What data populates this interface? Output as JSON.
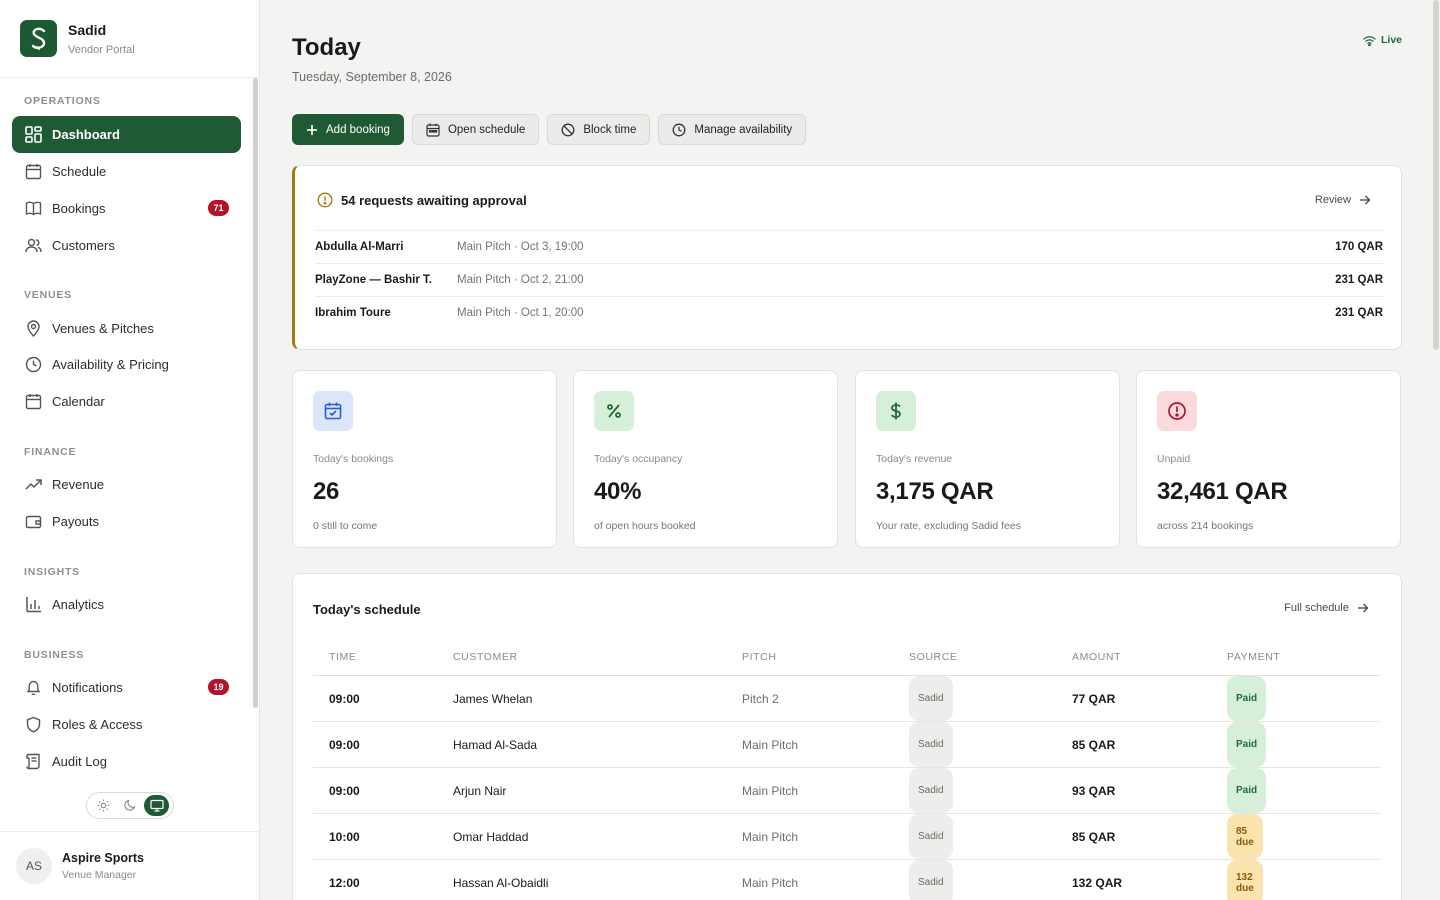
{
  "brand": {
    "name": "Sadid",
    "subtitle": "Vendor Portal"
  },
  "sidebar": {
    "sections": {
      "operations": "OPERATIONS",
      "venues": "VENUES",
      "finance": "FINANCE",
      "insights": "INSIGHTS",
      "business": "BUSINESS"
    },
    "items": [
      {
        "label": "Dashboard",
        "icon": "grid-icon",
        "active": true
      },
      {
        "label": "Schedule",
        "icon": "calendar-icon"
      },
      {
        "label": "Bookings",
        "icon": "book-icon",
        "badge": "71"
      },
      {
        "label": "Customers",
        "icon": "users-icon"
      },
      {
        "label": "Venues & Pitches",
        "icon": "map-pin-icon"
      },
      {
        "label": "Availability & Pricing",
        "icon": "clock-icon"
      },
      {
        "label": "Calendar",
        "icon": "calendar-icon"
      },
      {
        "label": "Revenue",
        "icon": "trending-up-icon"
      },
      {
        "label": "Payouts",
        "icon": "wallet-icon"
      },
      {
        "label": "Analytics",
        "icon": "bar-chart-icon"
      },
      {
        "label": "Notifications",
        "icon": "bell-icon",
        "badge": "19"
      },
      {
        "label": "Roles & Access",
        "icon": "shield-icon"
      },
      {
        "label": "Audit Log",
        "icon": "scroll-icon"
      }
    ]
  },
  "user": {
    "initials": "AS",
    "name": "Aspire Sports",
    "role": "Venue Manager"
  },
  "header": {
    "title": "Today",
    "date": "Tuesday, September 8, 2026",
    "status": "Live"
  },
  "actions": {
    "add_booking": "Add booking",
    "open_schedule": "Open schedule",
    "block_time": "Block time",
    "manage_availability": "Manage availability"
  },
  "approvals": {
    "title": "54 requests awaiting approval",
    "review_label": "Review",
    "rows": [
      {
        "name": "Abdulla Al-Marri",
        "detail": "Main Pitch · Oct 3, 19:00",
        "amount": "170 QAR"
      },
      {
        "name": "PlayZone — Bashir T.",
        "detail": "Main Pitch · Oct 2, 21:00",
        "amount": "231 QAR"
      },
      {
        "name": "Ibrahim Toure",
        "detail": "Main Pitch · Oct 1, 20:00",
        "amount": "231 QAR"
      }
    ]
  },
  "stats": [
    {
      "label": "Today's bookings",
      "value": "26",
      "sub": "0 still to come",
      "icon": "calendar-check-icon",
      "color": "#2a5bd7",
      "bg": "#dbe6fb"
    },
    {
      "label": "Today's occupancy",
      "value": "40%",
      "sub": "of open hours booked",
      "icon": "percent-icon",
      "color": "#1f6b3a",
      "bg": "#d6efd9"
    },
    {
      "label": "Today's revenue",
      "value": "3,175 QAR",
      "sub": "Your rate, excluding Sadid fees",
      "icon": "dollar-icon",
      "color": "#1f6b3a",
      "bg": "#d6efd9"
    },
    {
      "label": "Unpaid",
      "value": "32,461 QAR",
      "sub": "across 214 bookings",
      "icon": "alert-circle-icon",
      "color": "#b3122a",
      "bg": "#fbdadd"
    }
  ],
  "schedule": {
    "title": "Today's schedule",
    "link_label": "Full schedule",
    "columns": [
      "TIME",
      "CUSTOMER",
      "PITCH",
      "SOURCE",
      "AMOUNT",
      "PAYMENT"
    ],
    "rows": [
      {
        "time": "09:00",
        "customer": "James Whelan",
        "pitch": "Pitch 2",
        "source": "Sadid",
        "amount": "77 QAR",
        "payment": "Paid",
        "status": "paid"
      },
      {
        "time": "09:00",
        "customer": "Hamad Al-Sada",
        "pitch": "Main Pitch",
        "source": "Sadid",
        "amount": "85 QAR",
        "payment": "Paid",
        "status": "paid"
      },
      {
        "time": "09:00",
        "customer": "Arjun Nair",
        "pitch": "Main Pitch",
        "source": "Sadid",
        "amount": "93 QAR",
        "payment": "Paid",
        "status": "paid"
      },
      {
        "time": "10:00",
        "customer": "Omar Haddad",
        "pitch": "Main Pitch",
        "source": "Sadid",
        "amount": "85 QAR",
        "payment": "85 due",
        "status": "due"
      },
      {
        "time": "12:00",
        "customer": "Hassan Al-Obaidli",
        "pitch": "Main Pitch",
        "source": "Sadid",
        "amount": "132 QAR",
        "payment": "132 due",
        "status": "due"
      }
    ]
  },
  "colors": {
    "accent": "#1f5a34",
    "badge": "#b3122a",
    "approval_border": "#a17b0e"
  }
}
